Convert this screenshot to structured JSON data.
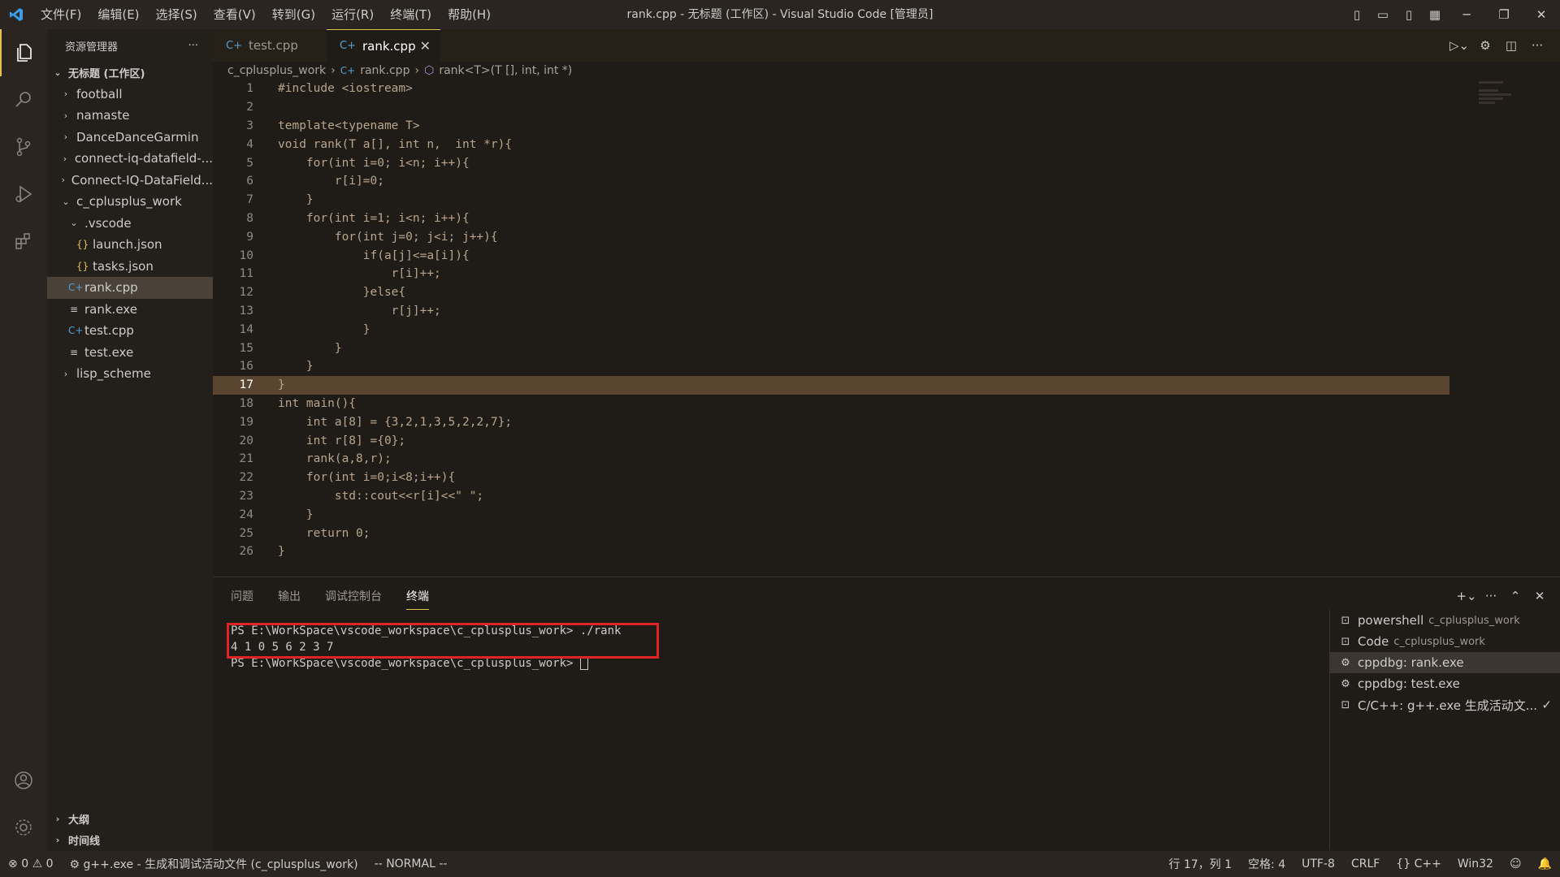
{
  "window": {
    "title": "rank.cpp - 无标题 (工作区) - Visual Studio Code [管理员]",
    "menu": [
      "文件(F)",
      "编辑(E)",
      "选择(S)",
      "查看(V)",
      "转到(G)",
      "运行(R)",
      "终端(T)",
      "帮助(H)"
    ]
  },
  "sidebar": {
    "header": "资源管理器",
    "workspace": "无标题 (工作区)",
    "items": [
      {
        "label": "football",
        "type": "folder",
        "expanded": false,
        "indent": 1
      },
      {
        "label": "namaste",
        "type": "folder",
        "expanded": false,
        "indent": 1
      },
      {
        "label": "DanceDanceGarmin",
        "type": "folder",
        "expanded": false,
        "indent": 1
      },
      {
        "label": "connect-iq-datafield-...",
        "type": "folder",
        "expanded": false,
        "indent": 1
      },
      {
        "label": "Connect-IQ-DataField...",
        "type": "folder",
        "expanded": false,
        "indent": 1
      },
      {
        "label": "c_cplusplus_work",
        "type": "folder",
        "expanded": true,
        "indent": 1
      },
      {
        "label": ".vscode",
        "type": "folder",
        "expanded": true,
        "indent": 2
      },
      {
        "label": "launch.json",
        "type": "json",
        "indent": 3
      },
      {
        "label": "tasks.json",
        "type": "json",
        "indent": 3
      },
      {
        "label": "rank.cpp",
        "type": "cpp",
        "indent": 2,
        "selected": true
      },
      {
        "label": "rank.exe",
        "type": "exe",
        "indent": 2
      },
      {
        "label": "test.cpp",
        "type": "cpp",
        "indent": 2
      },
      {
        "label": "test.exe",
        "type": "exe",
        "indent": 2
      },
      {
        "label": "lisp_scheme",
        "type": "folder",
        "expanded": false,
        "indent": 1
      }
    ],
    "outline": "大纲",
    "timeline": "时间线"
  },
  "editor": {
    "tabs": [
      {
        "label": "test.cpp",
        "active": false
      },
      {
        "label": "rank.cpp",
        "active": true
      }
    ],
    "breadcrumb": [
      "c_cplusplus_work",
      "rank.cpp",
      "rank<T>(T [], int, int *)"
    ],
    "current_line": 17,
    "lines": [
      "#include <iostream>",
      "",
      "template<typename T>",
      "void rank(T a[], int n,  int *r){",
      "    for(int i=0; i<n; i++){",
      "        r[i]=0;",
      "    }",
      "    for(int i=1; i<n; i++){",
      "        for(int j=0; j<i; j++){",
      "            if(a[j]<=a[i]){",
      "                r[i]++;",
      "            }else{",
      "                r[j]++;",
      "            }",
      "        }",
      "    }",
      "}",
      "int main(){",
      "    int a[8] = {3,2,1,3,5,2,2,7};",
      "    int r[8] ={0};",
      "    rank(a,8,r);",
      "    for(int i=0;i<8;i++){",
      "        std::cout<<r[i]<<\" \";",
      "    }",
      "    return 0;",
      "}"
    ]
  },
  "panel": {
    "tabs": [
      "问题",
      "输出",
      "调试控制台",
      "终端"
    ],
    "active_tab": "终端",
    "terminal_lines": [
      "PS E:\\WorkSpace\\vscode_workspace\\c_cplusplus_work> ./rank",
      "4 1 0 5 6 2 3 7",
      "PS E:\\WorkSpace\\vscode_workspace\\c_cplusplus_work> "
    ],
    "terminals": [
      {
        "name": "powershell",
        "sub": "c_cplusplus_work",
        "icon": "terminal-icon"
      },
      {
        "name": "Code",
        "sub": "c_cplusplus_work",
        "icon": "terminal-icon"
      },
      {
        "name": "cppdbg: rank.exe",
        "sub": "",
        "icon": "debug-icon",
        "selected": true
      },
      {
        "name": "cppdbg: test.exe",
        "sub": "",
        "icon": "debug-icon"
      },
      {
        "name": "C/C++: g++.exe 生成活动文...",
        "sub": "",
        "icon": "terminal-icon",
        "check": true
      }
    ]
  },
  "statusbar": {
    "errors": "0",
    "warnings": "0",
    "task": "g++.exe - 生成和调试活动文件 (c_cplusplus_work)",
    "mode": "-- NORMAL --",
    "position": "行 17，列 1",
    "spaces": "空格: 4",
    "encoding": "UTF-8",
    "eol": "CRLF",
    "language": "C++",
    "platform": "Win32"
  },
  "colors": {
    "accent": "#e3c14a",
    "highlight_box": "#e02424",
    "cpp_icon": "#5a9ecf"
  }
}
